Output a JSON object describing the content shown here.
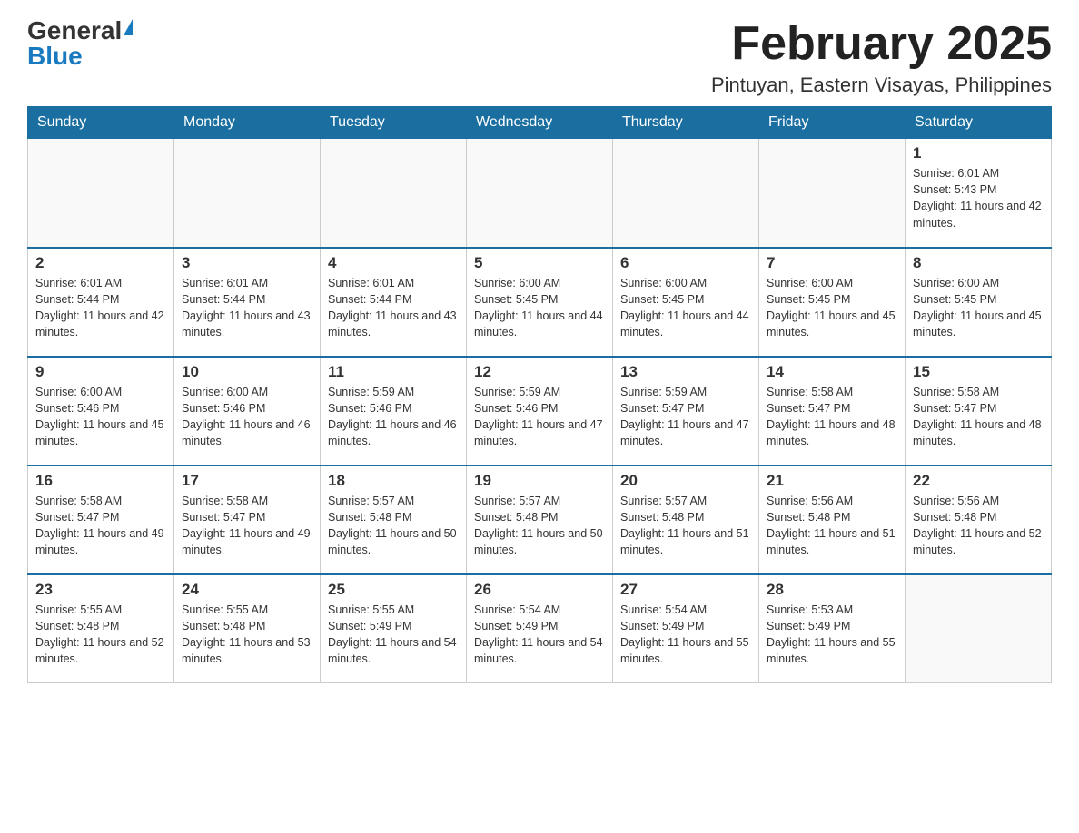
{
  "logo": {
    "general": "General",
    "blue": "Blue"
  },
  "title": "February 2025",
  "location": "Pintuyan, Eastern Visayas, Philippines",
  "days_of_week": [
    "Sunday",
    "Monday",
    "Tuesday",
    "Wednesday",
    "Thursday",
    "Friday",
    "Saturday"
  ],
  "weeks": [
    [
      {
        "day": "",
        "info": ""
      },
      {
        "day": "",
        "info": ""
      },
      {
        "day": "",
        "info": ""
      },
      {
        "day": "",
        "info": ""
      },
      {
        "day": "",
        "info": ""
      },
      {
        "day": "",
        "info": ""
      },
      {
        "day": "1",
        "info": "Sunrise: 6:01 AM\nSunset: 5:43 PM\nDaylight: 11 hours and 42 minutes."
      }
    ],
    [
      {
        "day": "2",
        "info": "Sunrise: 6:01 AM\nSunset: 5:44 PM\nDaylight: 11 hours and 42 minutes."
      },
      {
        "day": "3",
        "info": "Sunrise: 6:01 AM\nSunset: 5:44 PM\nDaylight: 11 hours and 43 minutes."
      },
      {
        "day": "4",
        "info": "Sunrise: 6:01 AM\nSunset: 5:44 PM\nDaylight: 11 hours and 43 minutes."
      },
      {
        "day": "5",
        "info": "Sunrise: 6:00 AM\nSunset: 5:45 PM\nDaylight: 11 hours and 44 minutes."
      },
      {
        "day": "6",
        "info": "Sunrise: 6:00 AM\nSunset: 5:45 PM\nDaylight: 11 hours and 44 minutes."
      },
      {
        "day": "7",
        "info": "Sunrise: 6:00 AM\nSunset: 5:45 PM\nDaylight: 11 hours and 45 minutes."
      },
      {
        "day": "8",
        "info": "Sunrise: 6:00 AM\nSunset: 5:45 PM\nDaylight: 11 hours and 45 minutes."
      }
    ],
    [
      {
        "day": "9",
        "info": "Sunrise: 6:00 AM\nSunset: 5:46 PM\nDaylight: 11 hours and 45 minutes."
      },
      {
        "day": "10",
        "info": "Sunrise: 6:00 AM\nSunset: 5:46 PM\nDaylight: 11 hours and 46 minutes."
      },
      {
        "day": "11",
        "info": "Sunrise: 5:59 AM\nSunset: 5:46 PM\nDaylight: 11 hours and 46 minutes."
      },
      {
        "day": "12",
        "info": "Sunrise: 5:59 AM\nSunset: 5:46 PM\nDaylight: 11 hours and 47 minutes."
      },
      {
        "day": "13",
        "info": "Sunrise: 5:59 AM\nSunset: 5:47 PM\nDaylight: 11 hours and 47 minutes."
      },
      {
        "day": "14",
        "info": "Sunrise: 5:58 AM\nSunset: 5:47 PM\nDaylight: 11 hours and 48 minutes."
      },
      {
        "day": "15",
        "info": "Sunrise: 5:58 AM\nSunset: 5:47 PM\nDaylight: 11 hours and 48 minutes."
      }
    ],
    [
      {
        "day": "16",
        "info": "Sunrise: 5:58 AM\nSunset: 5:47 PM\nDaylight: 11 hours and 49 minutes."
      },
      {
        "day": "17",
        "info": "Sunrise: 5:58 AM\nSunset: 5:47 PM\nDaylight: 11 hours and 49 minutes."
      },
      {
        "day": "18",
        "info": "Sunrise: 5:57 AM\nSunset: 5:48 PM\nDaylight: 11 hours and 50 minutes."
      },
      {
        "day": "19",
        "info": "Sunrise: 5:57 AM\nSunset: 5:48 PM\nDaylight: 11 hours and 50 minutes."
      },
      {
        "day": "20",
        "info": "Sunrise: 5:57 AM\nSunset: 5:48 PM\nDaylight: 11 hours and 51 minutes."
      },
      {
        "day": "21",
        "info": "Sunrise: 5:56 AM\nSunset: 5:48 PM\nDaylight: 11 hours and 51 minutes."
      },
      {
        "day": "22",
        "info": "Sunrise: 5:56 AM\nSunset: 5:48 PM\nDaylight: 11 hours and 52 minutes."
      }
    ],
    [
      {
        "day": "23",
        "info": "Sunrise: 5:55 AM\nSunset: 5:48 PM\nDaylight: 11 hours and 52 minutes."
      },
      {
        "day": "24",
        "info": "Sunrise: 5:55 AM\nSunset: 5:48 PM\nDaylight: 11 hours and 53 minutes."
      },
      {
        "day": "25",
        "info": "Sunrise: 5:55 AM\nSunset: 5:49 PM\nDaylight: 11 hours and 54 minutes."
      },
      {
        "day": "26",
        "info": "Sunrise: 5:54 AM\nSunset: 5:49 PM\nDaylight: 11 hours and 54 minutes."
      },
      {
        "day": "27",
        "info": "Sunrise: 5:54 AM\nSunset: 5:49 PM\nDaylight: 11 hours and 55 minutes."
      },
      {
        "day": "28",
        "info": "Sunrise: 5:53 AM\nSunset: 5:49 PM\nDaylight: 11 hours and 55 minutes."
      },
      {
        "day": "",
        "info": ""
      }
    ]
  ]
}
